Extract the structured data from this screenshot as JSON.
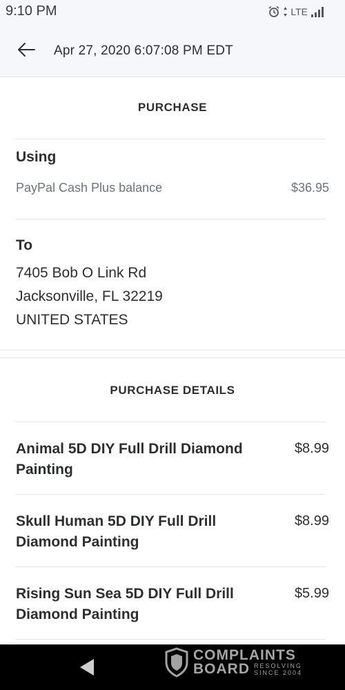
{
  "status_bar": {
    "time": "9:10 PM",
    "network": "LTE"
  },
  "header": {
    "title": "Apr 27, 2020 6:07:08 PM EDT"
  },
  "purchase": {
    "section_title": "PURCHASE",
    "using_label": "Using",
    "funding_source": "PayPal Cash Plus balance",
    "amount": "$36.95",
    "to_label": "To",
    "address_line1": "7405 Bob O Link Rd",
    "address_line2": "Jacksonville, FL 32219",
    "address_country": "UNITED STATES"
  },
  "details": {
    "section_title": "PURCHASE DETAILS",
    "items": [
      {
        "line1": "Animal 5D DIY Full Drill Diamond",
        "line2": "Painting",
        "price": "$8.99"
      },
      {
        "line1": "Skull Human 5D DIY Full Drill",
        "line2": "Diamond Painting",
        "price": "$8.99"
      },
      {
        "line1": "Rising Sun Sea 5D DIY Full Drill",
        "line2": "Diamond Painting",
        "price": "$5.99"
      }
    ]
  },
  "watermark": {
    "line1": "COMPLAINTS",
    "line2": "BOARD",
    "tag1": "RESOLVING",
    "tag2": "SINCE 2004"
  },
  "icons": {
    "back": "back-arrow-icon",
    "alarm": "alarm-icon",
    "signal": "signal-icon",
    "nav_back": "nav-back-icon",
    "shield": "shield-logo-icon"
  }
}
